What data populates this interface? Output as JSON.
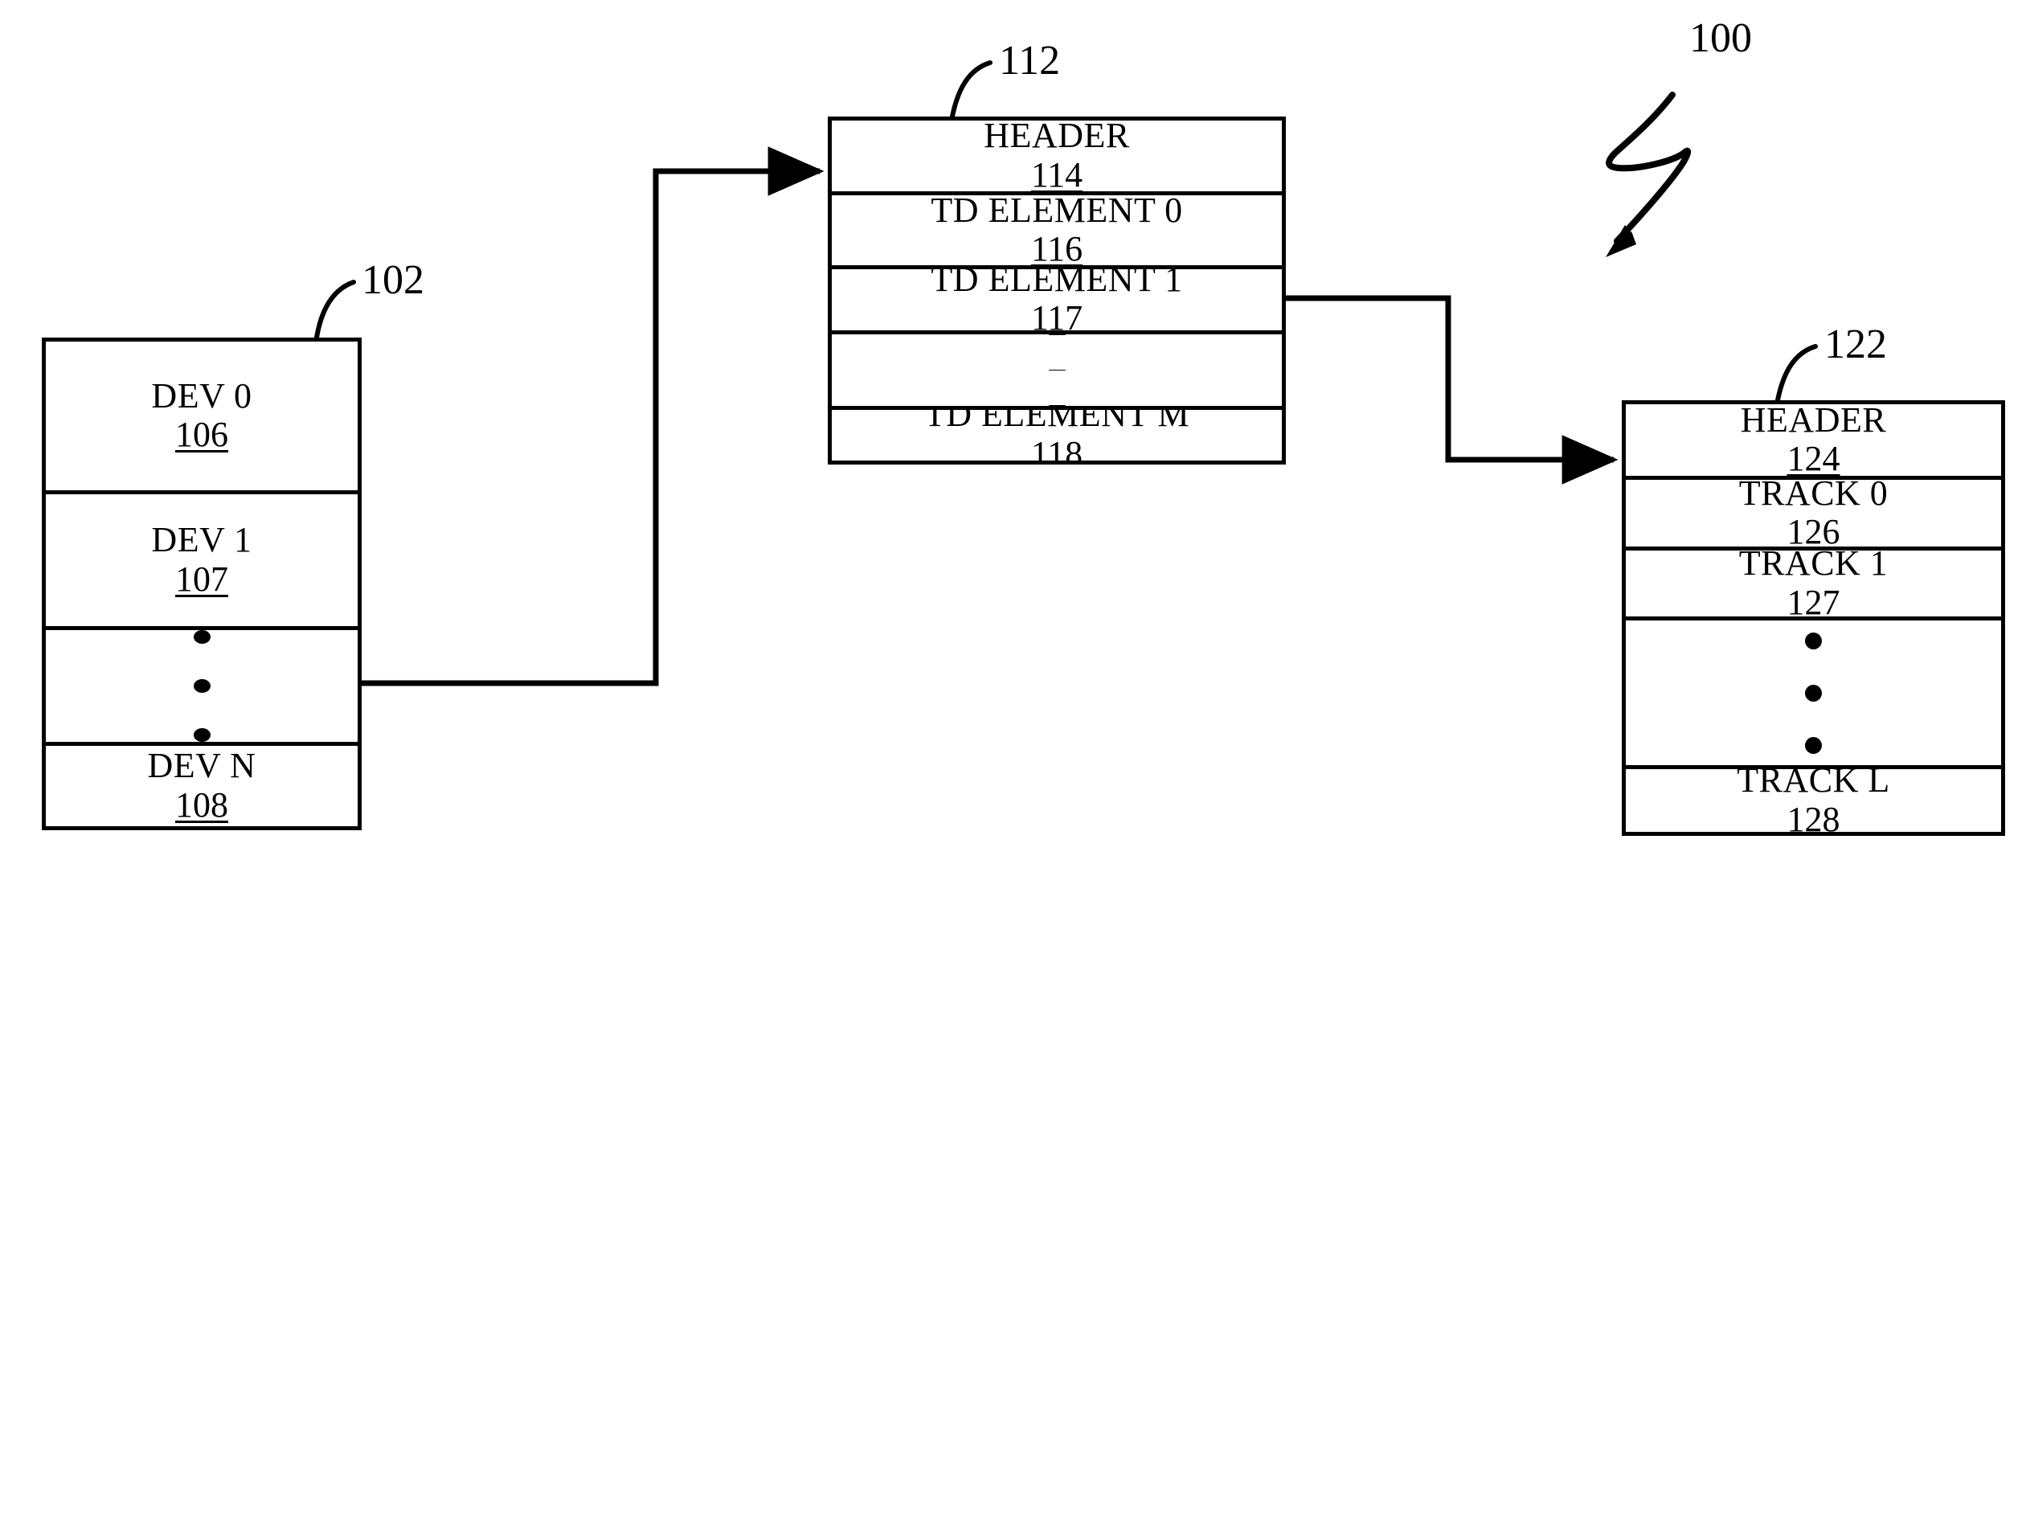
{
  "figure": {
    "overall_ref": "100",
    "background": "#ffffff",
    "ink": "#000000"
  },
  "device_table": {
    "ref": "102",
    "rows": [
      {
        "label": "DEV 0",
        "ref": "106",
        "kind": "entry"
      },
      {
        "label": "DEV 1",
        "ref": "107",
        "kind": "entry"
      },
      {
        "label": "",
        "ref": "",
        "kind": "ellipsis"
      },
      {
        "label": "DEV N",
        "ref": "108",
        "kind": "entry"
      }
    ]
  },
  "track_descriptor_table": {
    "ref": "112",
    "rows": [
      {
        "label": "HEADER",
        "ref": "114",
        "kind": "entry"
      },
      {
        "label": "TD ELEMENT 0",
        "ref": "116",
        "kind": "entry"
      },
      {
        "label": "TD ELEMENT 1",
        "ref": "117",
        "kind": "entry"
      },
      {
        "label": "",
        "ref": "",
        "kind": "ellipsis"
      },
      {
        "label": "TD ELEMENT M",
        "ref": "118",
        "kind": "entry"
      }
    ]
  },
  "track_table": {
    "ref": "122",
    "rows": [
      {
        "label": "HEADER",
        "ref": "124",
        "kind": "entry"
      },
      {
        "label": "TRACK 0",
        "ref": "126",
        "kind": "entry"
      },
      {
        "label": "TRACK 1",
        "ref": "127",
        "kind": "entry"
      },
      {
        "label": "",
        "ref": "",
        "kind": "ellipsis"
      },
      {
        "label": "TRACK L",
        "ref": "128",
        "kind": "entry"
      }
    ]
  },
  "connectors": [
    {
      "name": "dev1-to-td-table",
      "from": "DEV 1",
      "to": "HEADER 114"
    },
    {
      "name": "td-element-0-to-track-table",
      "from": "TD ELEMENT 0",
      "to": "HEADER 124"
    }
  ]
}
